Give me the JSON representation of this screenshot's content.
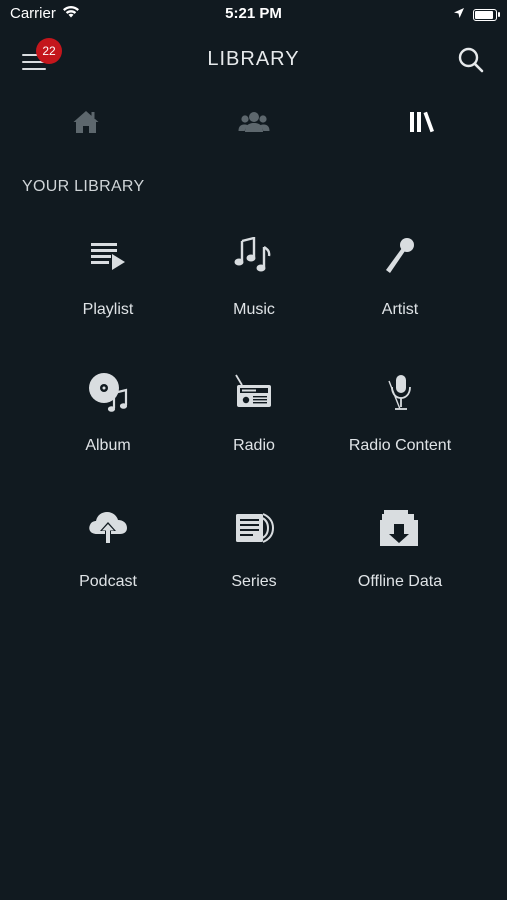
{
  "status_bar": {
    "carrier": "Carrier",
    "time": "5:21 PM",
    "battery_level": 1.0
  },
  "header": {
    "title": "LIBRARY",
    "notification_count": "22",
    "menu_icon": "hamburger-icon",
    "search_icon": "search-icon"
  },
  "tabs": [
    {
      "icon": "home-icon",
      "active": false
    },
    {
      "icon": "people-icon",
      "active": false
    },
    {
      "icon": "library-icon",
      "active": true
    }
  ],
  "library": {
    "section_title": "YOUR LIBRARY",
    "items": [
      {
        "label": "Playlist",
        "icon": "playlist-icon"
      },
      {
        "label": "Music",
        "icon": "music-notes-icon"
      },
      {
        "label": "Artist",
        "icon": "microphone-icon"
      },
      {
        "label": "Album",
        "icon": "album-disc-icon"
      },
      {
        "label": "Radio",
        "icon": "radio-icon"
      },
      {
        "label": "Radio Content",
        "icon": "radio-mic-icon"
      },
      {
        "label": "Podcast",
        "icon": "cloud-upload-icon"
      },
      {
        "label": "Series",
        "icon": "series-icon"
      },
      {
        "label": "Offline Data",
        "icon": "offline-download-icon"
      }
    ]
  },
  "colors": {
    "background": "#111a20",
    "badge": "#c4161c",
    "text": "#d9dde0",
    "inactive_tab": "#5d676d"
  }
}
